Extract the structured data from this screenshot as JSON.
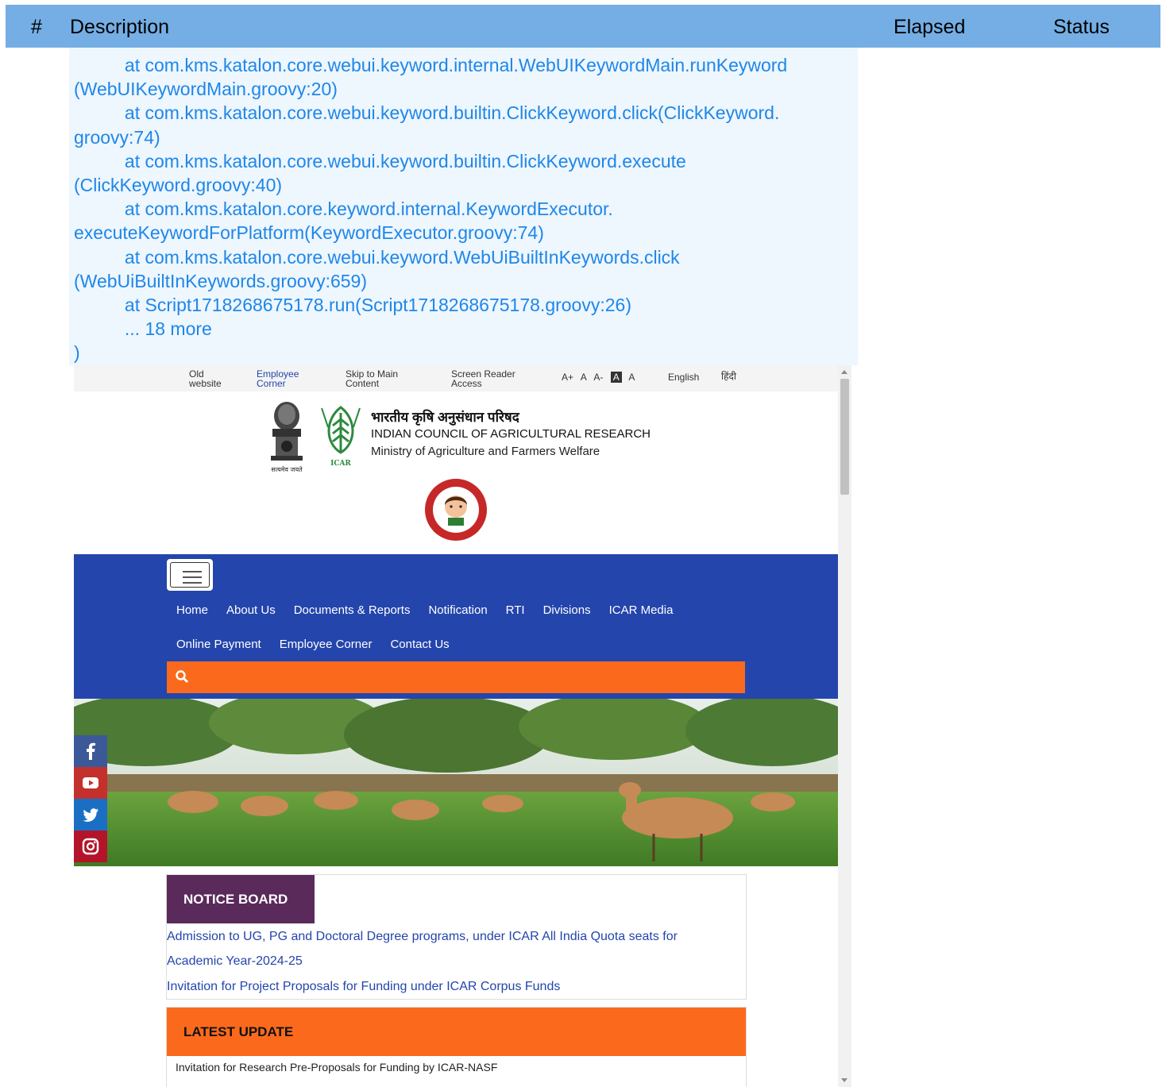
{
  "report_header": {
    "num": "#",
    "description": "Description",
    "elapsed": "Elapsed",
    "status": "Status"
  },
  "trace_lines": [
    "          at com.kms.katalon.core.webui.keyword.internal.WebUIKeywordMain.runKeyword",
    "(WebUIKeywordMain.groovy:20)",
    "          at com.kms.katalon.core.webui.keyword.builtin.ClickKeyword.click(ClickKeyword.",
    "groovy:74)",
    "          at com.kms.katalon.core.webui.keyword.builtin.ClickKeyword.execute",
    "(ClickKeyword.groovy:40)",
    "          at com.kms.katalon.core.keyword.internal.KeywordExecutor.",
    "executeKeywordForPlatform(KeywordExecutor.groovy:74)",
    "          at com.kms.katalon.core.webui.keyword.WebUiBuiltInKeywords.click",
    "(WebUiBuiltInKeywords.groovy:659)",
    "          at Script1718268675178.run(Script1718268675178.groovy:26)",
    "          ... 18 more",
    ")"
  ],
  "site": {
    "topbar": {
      "old_website_1": "Old",
      "old_website_2": "website",
      "employee_1": "Employee",
      "employee_2": "Corner",
      "skip_1": "Skip to Main",
      "skip_2": "Content",
      "screen_1": "Screen Reader",
      "screen_2": "Access",
      "font_plus": "A+",
      "font_normal": "A",
      "font_minus": "A-",
      "contrast_dark": "A",
      "contrast_light": "A",
      "english": "English",
      "hindi": "हिंदी"
    },
    "org": {
      "hindi_name": "भारतीय कृषि अनुसंधान परिषद",
      "name": "INDIAN COUNCIL OF AGRICULTURAL RESEARCH",
      "ministry": "Ministry of Agriculture and Farmers Welfare",
      "emblem_caption": "सत्यमेव जयते",
      "icar_caption": "ICAR"
    },
    "nav_row1": [
      "Home",
      "About Us",
      "Documents & Reports",
      "Notification",
      "RTI",
      "Divisions",
      "ICAR Media"
    ],
    "nav_row2": [
      "Online Payment",
      "Employee Corner",
      "Contact Us"
    ],
    "notice_board": {
      "title": "NOTICE BOARD",
      "items": [
        "Admission to UG, PG and Doctoral Degree programs, under ICAR All India Quota seats for",
        "Academic Year-2024-25",
        "Invitation for Project Proposals for Funding under ICAR Corpus Funds"
      ]
    },
    "latest_update": {
      "title": "LATEST UPDATE",
      "item": "Invitation for Research Pre-Proposals for Funding by ICAR-NASF"
    },
    "social": [
      "facebook-icon",
      "youtube-icon",
      "twitter-icon",
      "instagram-icon"
    ]
  },
  "colors": {
    "header_bg": "#74aee4",
    "trace_bg": "#eef6fe",
    "trace_text": "#1e87e8",
    "nav_blue": "#2445ac",
    "orange": "#fb6a1c",
    "notice_purple": "#5a2a5a"
  }
}
